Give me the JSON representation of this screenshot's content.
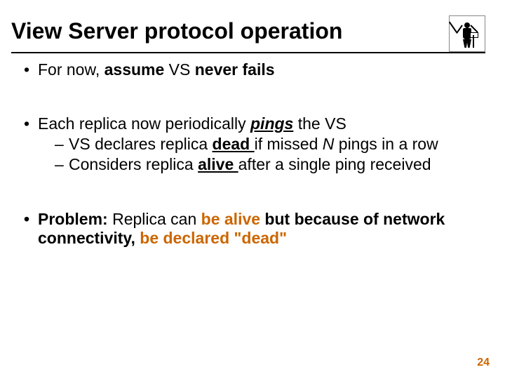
{
  "title": "View Server protocol operation",
  "bullets": {
    "b1_pre": "For now, ",
    "b1_bold1": "assume",
    "b1_mid": " VS ",
    "b1_bold2": "never fails",
    "b2_pre": "Each replica now periodically ",
    "b2_emph": "pings",
    "b2_post": " the VS",
    "b2a_pre": "VS declares replica ",
    "b2a_bold": "dead ",
    "b2a_mid1": "if missed ",
    "b2a_ital": "N",
    "b2a_mid2": " pings in a row",
    "b2b_pre": "Considers replica ",
    "b2b_bold": "alive ",
    "b2b_post": "after a single ping received",
    "b3_label": "Problem:",
    "b3_mid1": " Replica can ",
    "b3_acc1": "be alive",
    "b3_mid2": " but because of network connectivity, ",
    "b3_acc2": "be declared \"dead\""
  },
  "page_number": "24"
}
